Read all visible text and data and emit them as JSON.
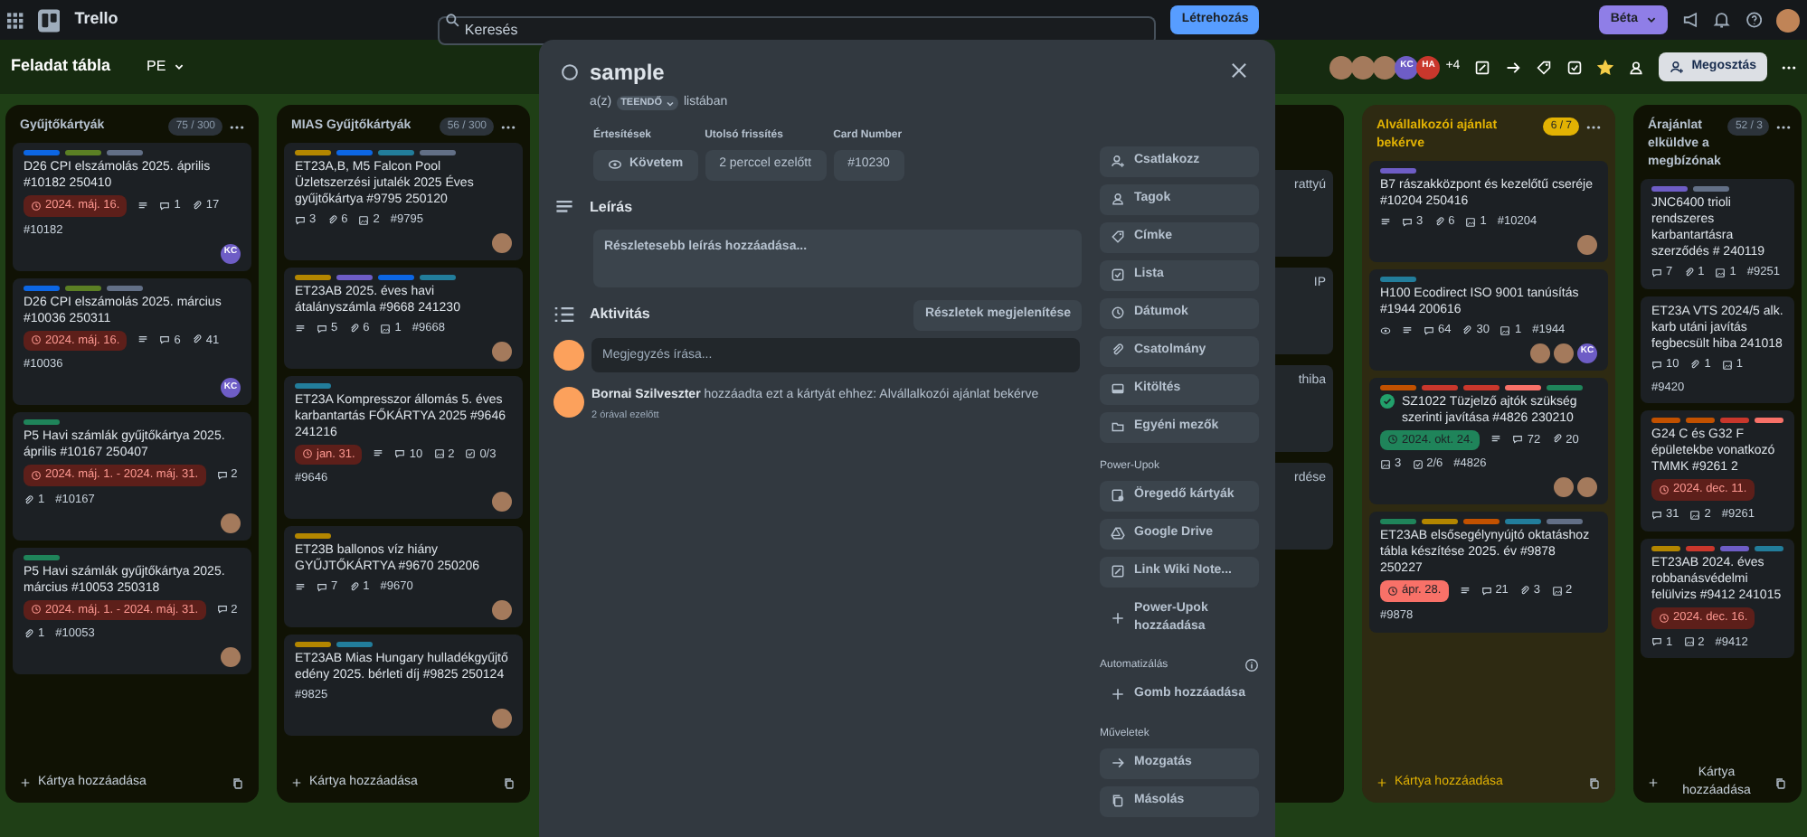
{
  "topbar": {
    "app_name": "Trello",
    "search": {
      "placeholder": "Keresés"
    },
    "create_button": "Létrehozás",
    "beta_button": "Béta"
  },
  "board_header": {
    "title": "Feladat tábla",
    "workspace": "PE",
    "members": [
      {
        "kind": "photo"
      },
      {
        "kind": "photo"
      },
      {
        "kind": "photo"
      },
      {
        "kind": "initials",
        "text": "KC",
        "color": "#6e5dc6"
      },
      {
        "kind": "initials",
        "text": "HA",
        "color": "#c9372c"
      }
    ],
    "more_members": "+4",
    "share_button": "Megosztás",
    "starred": true
  },
  "lists": [
    {
      "kind": "list",
      "title": "Gyűjtőkártyák",
      "count": "75 / 300",
      "highlighted": false,
      "cards": [
        {
          "labels": [
            {
              "color": "#0c66e4"
            },
            {
              "color": "#5b7f24"
            },
            {
              "color": "#626f86"
            }
          ],
          "title": "D26 CPI elszámolás 2025. április #10182 250410",
          "due": {
            "text": "2024. máj. 16.",
            "kind": "overdue"
          },
          "badges": [
            {
              "kind": "description"
            },
            {
              "kind": "comment",
              "text": "1"
            },
            {
              "kind": "attachment",
              "text": "17"
            },
            {
              "kind": "number",
              "text": "#10182"
            }
          ],
          "members": [
            {
              "kind": "initials",
              "text": "KC",
              "color": "#6e5dc6"
            }
          ]
        },
        {
          "labels": [
            {
              "color": "#0c66e4"
            },
            {
              "color": "#5b7f24"
            },
            {
              "color": "#626f86"
            }
          ],
          "title": "D26 CPI elszámolás 2025. március #10036 250311",
          "due": {
            "text": "2024. máj. 16.",
            "kind": "overdue"
          },
          "badges": [
            {
              "kind": "description"
            },
            {
              "kind": "comment",
              "text": "6"
            },
            {
              "kind": "attachment",
              "text": "41"
            },
            {
              "kind": "number",
              "text": "#10036"
            }
          ],
          "members": [
            {
              "kind": "initials",
              "text": "KC",
              "color": "#6e5dc6"
            }
          ]
        },
        {
          "labels": [
            {
              "color": "#1f845a"
            }
          ],
          "title": "P5 Havi számlák gyűjtőkártya 2025. április #10167 250407",
          "due": {
            "text": "2024. máj. 1. - 2024. máj. 31.",
            "kind": "overdue"
          },
          "badges": [
            {
              "kind": "comment",
              "text": "2"
            },
            {
              "kind": "attachment",
              "text": "1"
            },
            {
              "kind": "number",
              "text": "#10167"
            }
          ],
          "members": [
            {
              "kind": "photo"
            }
          ]
        },
        {
          "labels": [
            {
              "color": "#1f845a"
            }
          ],
          "title": "P5 Havi számlák gyűjtőkártya 2025. március #10053 250318",
          "due": {
            "text": "2024. máj. 1. - 2024. máj. 31.",
            "kind": "overdue"
          },
          "badges": [
            {
              "kind": "comment",
              "text": "2"
            },
            {
              "kind": "attachment",
              "text": "1"
            },
            {
              "kind": "number",
              "text": "#10053"
            }
          ],
          "members": [
            {
              "kind": "photo"
            }
          ]
        }
      ],
      "add_card": "Kártya hozzáadása"
    },
    {
      "kind": "list",
      "title": "MIAS Gyűjtőkártyák",
      "count": "56 / 300",
      "highlighted": false,
      "cards": [
        {
          "labels": [
            {
              "color": "#b38600"
            },
            {
              "color": "#0c66e4"
            },
            {
              "color": "#227d9b"
            },
            {
              "color": "#626f86"
            }
          ],
          "title": "ET23A,B, M5 Falcon Pool Üzletszerzési jutalék 2025 Éves gyűjtőkártya #9795 250120",
          "badges": [
            {
              "kind": "comment",
              "text": "3"
            },
            {
              "kind": "attachment",
              "text": "6"
            },
            {
              "kind": "image",
              "text": "2"
            },
            {
              "kind": "number",
              "text": "#9795"
            }
          ],
          "members": [
            {
              "kind": "photo"
            }
          ]
        },
        {
          "labels": [
            {
              "color": "#b38600"
            },
            {
              "color": "#6e5dc6"
            },
            {
              "color": "#0c66e4"
            },
            {
              "color": "#227d9b"
            }
          ],
          "title": "ET23AB 2025. éves havi átalányszámla #9668 241230",
          "badges": [
            {
              "kind": "description"
            },
            {
              "kind": "comment",
              "text": "5"
            },
            {
              "kind": "attachment",
              "text": "6"
            },
            {
              "kind": "image",
              "text": "1"
            },
            {
              "kind": "number",
              "text": "#9668"
            }
          ],
          "members": [
            {
              "kind": "photo"
            }
          ]
        },
        {
          "labels": [
            {
              "color": "#227d9b"
            }
          ],
          "title": "ET23A Kompresszor állomás 5. éves karbantartás FŐKÁRTYA 2025 #9646 241216",
          "due": {
            "text": "jan. 31.",
            "kind": "overdue"
          },
          "badges": [
            {
              "kind": "description"
            },
            {
              "kind": "comment",
              "text": "10"
            },
            {
              "kind": "image",
              "text": "2"
            },
            {
              "kind": "checklist",
              "text": "0/3"
            },
            {
              "kind": "number",
              "text": "#9646"
            }
          ],
          "members": [
            {
              "kind": "photo"
            }
          ]
        },
        {
          "labels": [
            {
              "color": "#b38600"
            }
          ],
          "title": "ET23B ballonos víz hiány GYŰJTŐKÁRTYA #9670 250206",
          "badges": [
            {
              "kind": "description"
            },
            {
              "kind": "comment",
              "text": "7"
            },
            {
              "kind": "attachment",
              "text": "1"
            },
            {
              "kind": "number",
              "text": "#9670"
            }
          ],
          "members": [
            {
              "kind": "photo"
            }
          ]
        },
        {
          "labels": [
            {
              "color": "#b38600"
            },
            {
              "color": "#227d9b"
            }
          ],
          "title": "ET23AB Mias Hungary hulladékgyűjtő edény 2025. bérleti díj #9825 250124",
          "badges": [
            {
              "kind": "number",
              "text": "#9825"
            }
          ],
          "members": [
            {
              "kind": "photo"
            }
          ]
        }
      ],
      "add_card": "Kártya hozzáadása"
    },
    {
      "kind": "partial",
      "cards": [
        {
          "title": "rattyú"
        },
        {
          "title": "IP"
        },
        {
          "title": "thiba"
        },
        {
          "title": "rdése"
        }
      ]
    },
    {
      "kind": "list",
      "title": "Alvállalkozói ajánlat bekérve",
      "count": "6 / 7",
      "highlighted": true,
      "cards": [
        {
          "labels": [
            {
              "color": "#6e5dc6"
            }
          ],
          "title": "B7 rászakközpont és kezelőtű cseréje #10204 250416",
          "badges": [
            {
              "kind": "description"
            },
            {
              "kind": "comment",
              "text": "3"
            },
            {
              "kind": "attachment",
              "text": "6"
            },
            {
              "kind": "image",
              "text": "1"
            },
            {
              "kind": "number",
              "text": "#10204"
            }
          ],
          "members": [
            {
              "kind": "photo"
            }
          ]
        },
        {
          "labels": [
            {
              "color": "#227d9b"
            }
          ],
          "title": "H100 Ecodirect ISO 9001 tanúsítás #1944 200616",
          "badges": [
            {
              "kind": "watch"
            },
            {
              "kind": "description"
            },
            {
              "kind": "comment",
              "text": "64"
            },
            {
              "kind": "attachment",
              "text": "30"
            },
            {
              "kind": "image",
              "text": "1"
            },
            {
              "kind": "number",
              "text": "#1944"
            }
          ],
          "members": [
            {
              "kind": "photo"
            },
            {
              "kind": "photo"
            },
            {
              "kind": "initials",
              "text": "KC",
              "color": "#6e5dc6"
            }
          ]
        },
        {
          "labels": [
            {
              "color": "#c25100"
            },
            {
              "color": "#c9372c"
            },
            {
              "color": "#c9372c"
            },
            {
              "color": "#f87168"
            },
            {
              "color": "#1f845a"
            }
          ],
          "done": true,
          "title": "SZ1022 Tüzjelző ajtók szükség szerinti javítása #4826 230210",
          "due": {
            "text": "2024. okt. 24.",
            "kind": "complete"
          },
          "badges": [
            {
              "kind": "description"
            },
            {
              "kind": "comment",
              "text": "72"
            },
            {
              "kind": "attachment",
              "text": "20"
            },
            {
              "kind": "image",
              "text": "3"
            },
            {
              "kind": "checklist",
              "text": "2/6"
            },
            {
              "kind": "number",
              "text": "#4826"
            }
          ],
          "members": [
            {
              "kind": "photo"
            },
            {
              "kind": "photo"
            }
          ]
        },
        {
          "labels": [
            {
              "color": "#1f845a"
            },
            {
              "color": "#b38600"
            },
            {
              "color": "#c25100"
            },
            {
              "color": "#227d9b"
            },
            {
              "color": "#626f86"
            }
          ],
          "title": "ET23AB elsősegélynyújtó oktatáshoz tábla készítése 2025. év #9878 250227",
          "due": {
            "text": "ápr. 28.",
            "kind": "soon"
          },
          "badges": [
            {
              "kind": "description"
            },
            {
              "kind": "comment",
              "text": "21"
            },
            {
              "kind": "attachment",
              "text": "3"
            },
            {
              "kind": "image",
              "text": "2"
            },
            {
              "kind": "number",
              "text": "#9878"
            }
          ]
        }
      ],
      "add_card": "Kártya hozzáadása"
    },
    {
      "kind": "list",
      "title": "Árajánlat elküldve a megbízónak",
      "count": "52 / 3",
      "highlighted": false,
      "cards": [
        {
          "labels": [
            {
              "color": "#6e5dc6"
            },
            {
              "color": "#626f86"
            }
          ],
          "title": "JNC6400 trioli rendszeres karbantartásra szerződés # 240119",
          "badges": [
            {
              "kind": "comment",
              "text": "7"
            },
            {
              "kind": "attachment",
              "text": "1"
            },
            {
              "kind": "image",
              "text": "1"
            },
            {
              "kind": "number",
              "text": "#9251"
            }
          ]
        },
        {
          "title": "ET23A VTS 2024/5 alk. karb utáni javítás fegbecsült hiba 241018",
          "badges": [
            {
              "kind": "comment",
              "text": "10"
            },
            {
              "kind": "attachment",
              "text": "1"
            },
            {
              "kind": "image",
              "text": "1"
            },
            {
              "kind": "number",
              "text": "#9420"
            }
          ]
        },
        {
          "labels": [
            {
              "color": "#c25100"
            },
            {
              "color": "#c25100"
            },
            {
              "color": "#c9372c"
            },
            {
              "color": "#f87168"
            }
          ],
          "title": "G24 C és G32 F épületekbe vonatkozó TMMK #9261 2",
          "due": {
            "text": "2024. dec. 11.",
            "kind": "overdue"
          },
          "badges": [
            {
              "kind": "comment",
              "text": "31"
            },
            {
              "kind": "image",
              "text": "2"
            },
            {
              "kind": "number",
              "text": "#9261"
            }
          ]
        },
        {
          "labels": [
            {
              "color": "#b38600"
            },
            {
              "color": "#c9372c"
            },
            {
              "color": "#6e5dc6"
            },
            {
              "color": "#227d9b"
            }
          ],
          "title": "ET23AB 2024. éves robbanásvédelmi felülvizs #9412 241015",
          "due": {
            "text": "2024. dec. 16.",
            "kind": "overdue"
          },
          "badges": [
            {
              "kind": "comment",
              "text": "1"
            },
            {
              "kind": "image",
              "text": "2"
            },
            {
              "kind": "number",
              "text": "#9412"
            }
          ]
        }
      ],
      "add_card": "Kártya hozzáadása"
    }
  ],
  "card_modal": {
    "title": "sample",
    "list_prefix": "a(z)",
    "list_name": "TEENDŐ",
    "list_suffix": "listában",
    "fields": [
      {
        "label": "Értesítések",
        "value": "Követem",
        "kind": "watch"
      },
      {
        "label": "Utolsó frissítés",
        "value": "2 perccel ezelőtt",
        "kind": "text"
      },
      {
        "label": "Card Number",
        "value": "#10230",
        "kind": "text"
      }
    ],
    "description": {
      "heading": "Leírás",
      "placeholder": "Részletesebb leírás hozzáadása..."
    },
    "activity": {
      "heading": "Aktivitás",
      "details_button": "Részletek megjelenítése",
      "comment_placeholder": "Megjegyzés írása...",
      "entries": [
        {
          "author": "Bornai Szilveszter",
          "text": "hozzáadta ezt a kártyát ehhez: Alvállalkozói ajánlat bekérve",
          "time": "2 órával ezelőtt"
        }
      ]
    },
    "sidebar": [
      {
        "kind": "button",
        "label": "Csatlakozz"
      },
      {
        "kind": "button",
        "label": "Tagok"
      },
      {
        "kind": "button",
        "label": "Címke"
      },
      {
        "kind": "button",
        "label": "Lista"
      },
      {
        "kind": "button",
        "label": "Dátumok"
      },
      {
        "kind": "button",
        "label": "Csatolmány"
      },
      {
        "kind": "button",
        "label": "Kitöltés"
      },
      {
        "kind": "button",
        "label": "Egyéni mezők"
      },
      {
        "kind": "heading",
        "label": "Power-Upok"
      },
      {
        "kind": "button",
        "label": "Öregedő kártyák"
      },
      {
        "kind": "button",
        "label": "Google Drive"
      },
      {
        "kind": "button",
        "label": "Link Wiki Note..."
      },
      {
        "kind": "add",
        "label": "Power-Upok hozzáadása"
      },
      {
        "kind": "heading",
        "label": "Automatizálás"
      },
      {
        "kind": "add",
        "label": "Gomb hozzáadása"
      },
      {
        "kind": "heading",
        "label": "Műveletek"
      },
      {
        "kind": "button",
        "label": "Mozgatás"
      },
      {
        "kind": "button",
        "label": "Másolás"
      }
    ]
  }
}
